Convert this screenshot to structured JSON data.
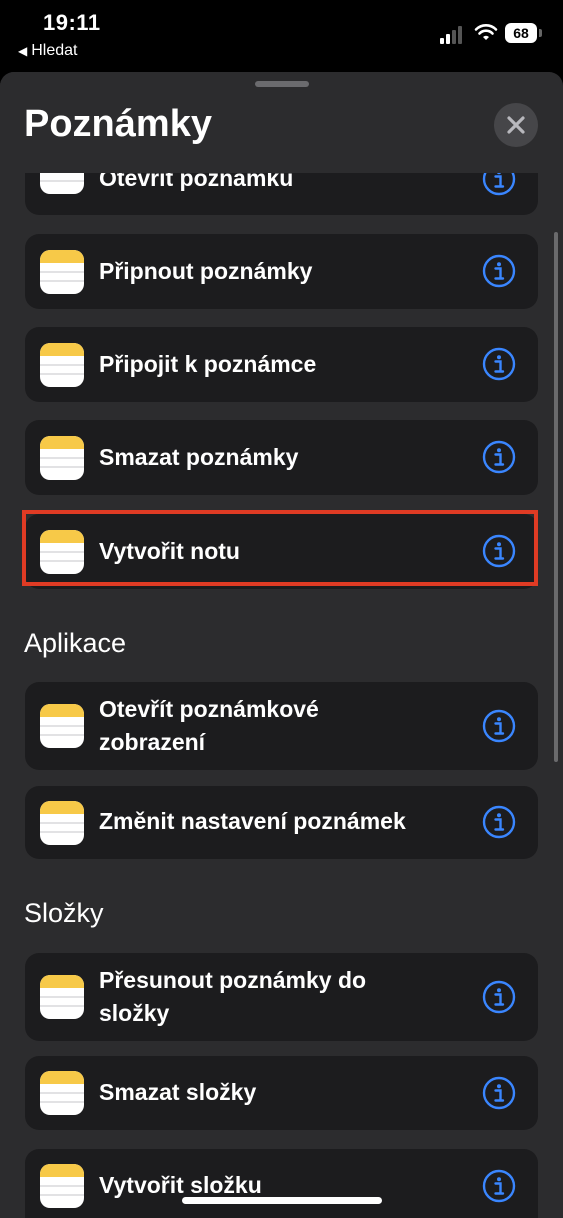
{
  "status_bar": {
    "time": "19:11",
    "back_label": "Hledat",
    "battery": "68"
  },
  "sheet": {
    "title": "Poznámky"
  },
  "actions_top": [
    {
      "label": "Otevřít poznámku",
      "icon": "notes-app-icon"
    },
    {
      "label": "Připnout poznámky",
      "icon": "notes-app-icon"
    },
    {
      "label": "Připojit k poznámce",
      "icon": "notes-app-icon"
    },
    {
      "label": "Smazat poznámky",
      "icon": "notes-app-icon"
    },
    {
      "label": "Vytvořit notu",
      "icon": "notes-app-icon",
      "highlighted": true
    }
  ],
  "sections": {
    "app": {
      "title": "Aplikace",
      "items": [
        {
          "label": "Otevřít poznámkové zobrazení",
          "icon": "notes-app-icon"
        },
        {
          "label": "Změnit nastavení poznámek",
          "icon": "notes-app-icon"
        }
      ]
    },
    "folders": {
      "title": "Složky",
      "items": [
        {
          "label": "Přesunout poznámky do složky",
          "icon": "notes-app-icon"
        },
        {
          "label": "Smazat složky",
          "icon": "notes-app-icon"
        },
        {
          "label": "Vytvořit složku",
          "icon": "notes-app-icon"
        }
      ]
    }
  },
  "colors": {
    "background": "#000000",
    "sheet": "#2c2c2e",
    "row": "#1c1c1e",
    "accent": "#3a86ff",
    "highlight": "#e03b24",
    "notes_yellow": "#f7c948"
  }
}
